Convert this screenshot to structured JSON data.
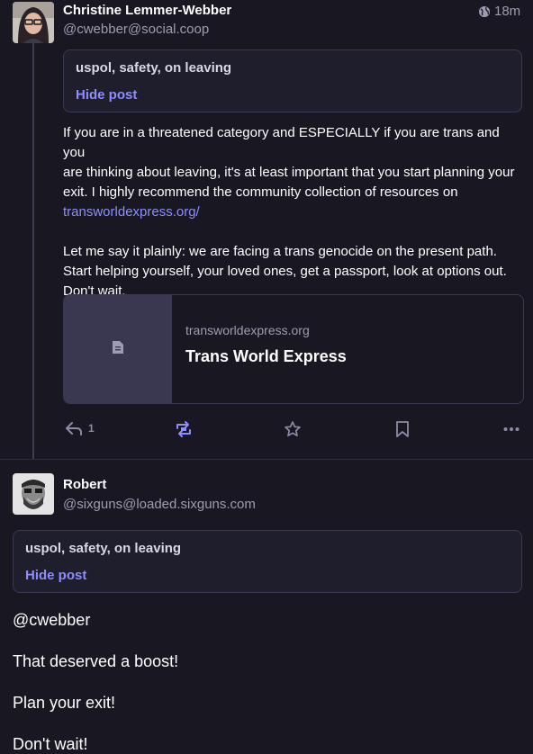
{
  "post1": {
    "display_name": "Christine Lemmer-Webber",
    "acct": "@cwebber@social.coop",
    "time": "18m",
    "cw": {
      "spoiler": "uspol, safety, on leaving",
      "hide_label": "Hide post"
    },
    "paragraph1_lines": [
      "If you are in a threatened category and ESPECIALLY if you are trans and you",
      "are thinking about leaving, it's at least important that you start planning your",
      "exit. I highly recommend the community collection of resources on"
    ],
    "link_text": "transworldexpress.org/",
    "paragraph2_lines": [
      "Let me say it plainly: we are facing a trans genocide on the present path.",
      "Start helping yourself, your loved ones, get a passport, look at options out.",
      "Don't wait."
    ],
    "card": {
      "domain": "transworldexpress.org",
      "title": "Trans World Express",
      "icon": "document-icon"
    },
    "actions": {
      "reply_count": "1",
      "reply_icon": "reply-icon",
      "boost_icon": "boost-icon",
      "favourite_icon": "star-icon",
      "bookmark_icon": "bookmark-icon",
      "more_icon": "more-icon",
      "boost_active_color": "#8c8dff"
    }
  },
  "post2": {
    "display_name": "Robert",
    "acct": "@sixguns@loaded.sixguns.com",
    "cw": {
      "spoiler": "uspol, safety, on leaving",
      "hide_label": "Hide post"
    },
    "lines": [
      "@cwebber",
      "That deserved a boost!",
      "Plan your exit!",
      "Don't wait!"
    ]
  },
  "colors": {
    "background": "#191822",
    "accent": "#8c8dff",
    "muted": "#9e9cb4",
    "border": "#3a3854"
  }
}
